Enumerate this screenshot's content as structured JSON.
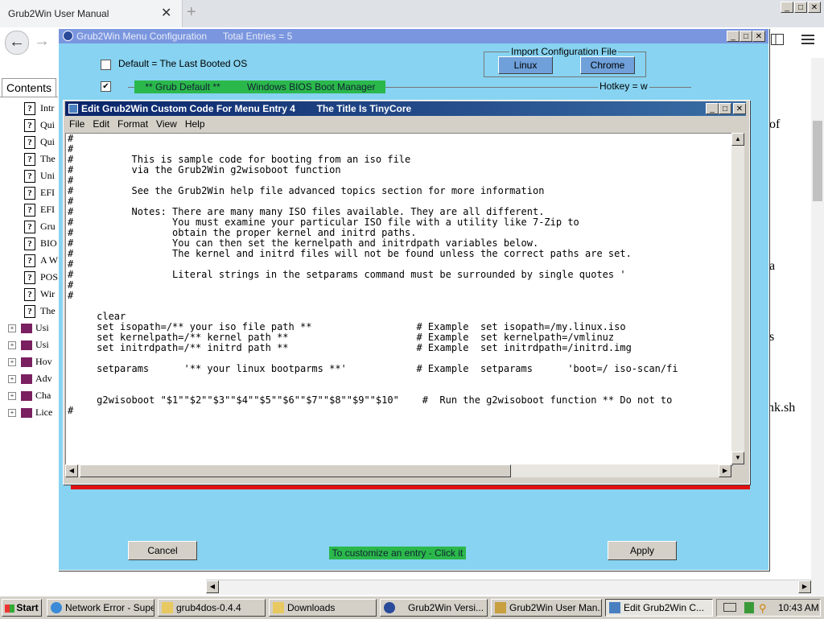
{
  "browser": {
    "tab_title": "Grub2Win User Manual",
    "tab_close": "✕",
    "new_tab": "+",
    "contents_tab": "Contents",
    "toc_items": [
      {
        "label": "Intr",
        "type": "help"
      },
      {
        "label": "Qui",
        "type": "help"
      },
      {
        "label": "Qui",
        "type": "help"
      },
      {
        "label": "The",
        "type": "help"
      },
      {
        "label": "Uni",
        "type": "help"
      },
      {
        "label": "EFI",
        "type": "help"
      },
      {
        "label": "EFI",
        "type": "help"
      },
      {
        "label": "Gru",
        "type": "help"
      },
      {
        "label": "BIO",
        "type": "help"
      },
      {
        "label": "A W",
        "type": "help"
      },
      {
        "label": "POS",
        "type": "help"
      },
      {
        "label": "Wir",
        "type": "help"
      },
      {
        "label": "The",
        "type": "help"
      },
      {
        "label": "Usi",
        "type": "book"
      },
      {
        "label": "Usi",
        "type": "book"
      },
      {
        "label": "Hov",
        "type": "book"
      },
      {
        "label": "Adv",
        "type": "book"
      },
      {
        "label": "Cha",
        "type": "book"
      },
      {
        "label": "Lice",
        "type": "book"
      }
    ],
    "bg_fragments": [
      "of",
      "a",
      "s",
      "nk.sh"
    ]
  },
  "menu_config": {
    "title": "Grub2Win Menu Configuration      Total Entries = 5",
    "default_label": "Default = The Last Booted OS",
    "import_label": "Import Configuration File",
    "import_linux": "Linux",
    "import_chrome": "Chrome",
    "entry_bar": "    ** Grub Default **          Windows BIOS Boot Manager",
    "hotkey": "Hotkey = w",
    "cancel": "Cancel",
    "apply": "Apply",
    "customize_hint": "To customize an entry - Click it"
  },
  "edit_window": {
    "title": "Edit Grub2Win Custom Code For Menu Entry 4        The Title Is TinyCore",
    "menu": [
      "File",
      "Edit",
      "Format",
      "View",
      "Help"
    ],
    "code": "#\n#\n#          This is sample code for booting from an iso file\n#          via the Grub2Win g2wisoboot function\n#\n#          See the Grub2Win help file advanced topics section for more information\n#\n#          Notes: There are many many ISO files available. They are all different.\n#                 You must examine your particular ISO file with a utility like 7-Zip to\n#                 obtain the proper kernel and initrd paths.\n#                 You can then set the kernelpath and initrdpath variables below.\n#                 The kernel and initrd files will not be found unless the correct paths are set.\n#\n#                 Literal strings in the setparams command must be surrounded by single quotes '\n#\n#\n\n     clear\n     set isopath=/** your iso file path **                  # Example  set isopath=/my.linux.iso\n     set kernelpath=/** kernel path **                      # Example  set kernelpath=/vmlinuz\n     set initrdpath=/** initrd path **                      # Example  set initrdpath=/initrd.img\n\n     setparams      '** your linux bootparms **'            # Example  setparams      'boot=/ iso-scan/fi\n\n\n     g2wisoboot \"$1\"\"$2\"\"$3\"\"$4\"\"$5\"\"$6\"\"$7\"\"$8\"\"$9\"\"$10\"    #  Run the g2wisoboot function ** Do not to\n#"
  },
  "taskbar": {
    "start": "Start",
    "tasks": [
      "Network Error - Supe...",
      "grub4dos-0.4.4",
      "Downloads",
      "Grub2Win   Versi...",
      "Grub2Win User Man...",
      "Edit Grub2Win C..."
    ],
    "clock": "10:43 AM"
  }
}
